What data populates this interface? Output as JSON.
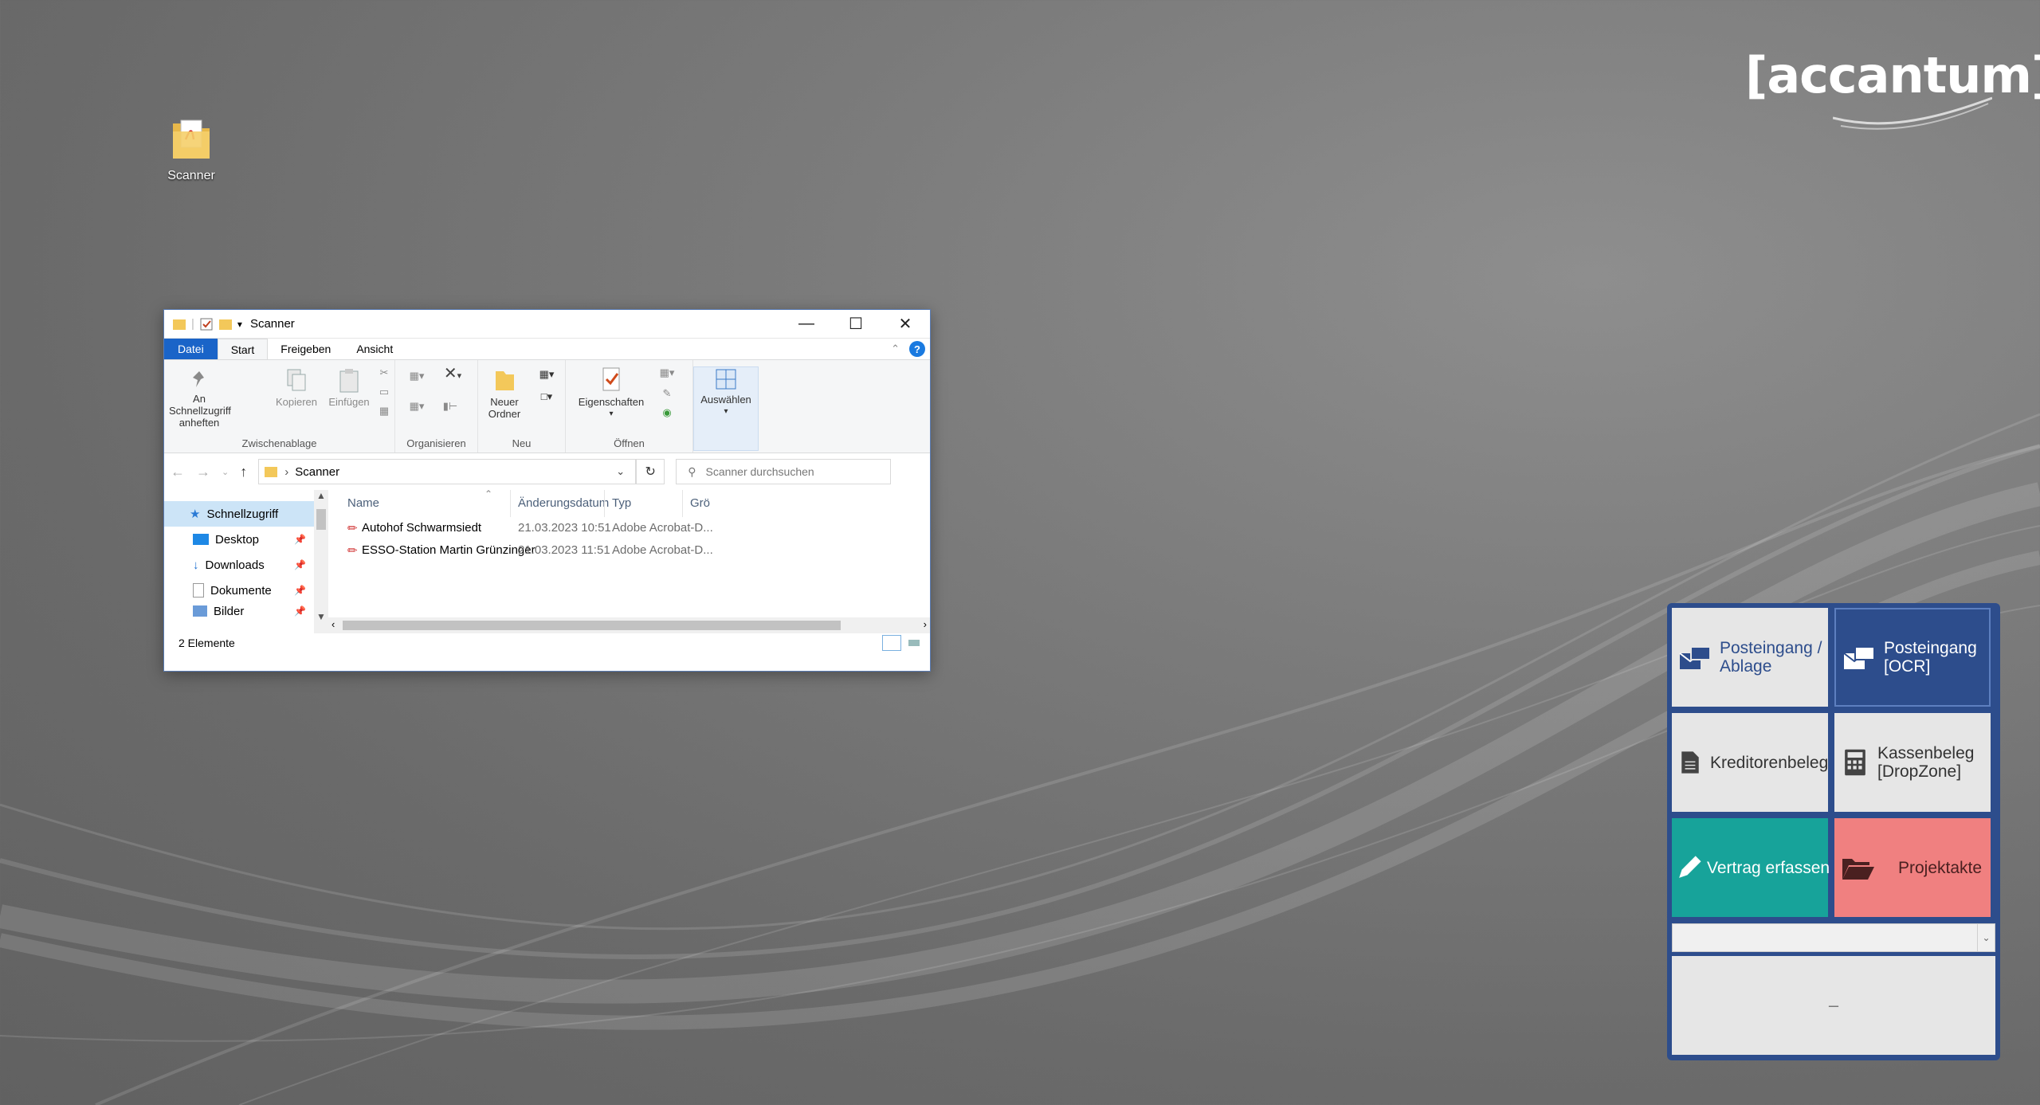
{
  "desktop": {
    "brand_text": "[accantum]",
    "icons": [
      {
        "label": "Scanner"
      }
    ]
  },
  "explorer": {
    "title": "Scanner",
    "tabs": {
      "file": "Datei",
      "start": "Start",
      "share": "Freigeben",
      "view": "Ansicht"
    },
    "ribbon": {
      "pin_quick": "An Schnellzugriff anheften",
      "copy": "Kopieren",
      "paste": "Einfügen",
      "group_clipboard": "Zwischenablage",
      "group_organize": "Organisieren",
      "new_folder": "Neuer Ordner",
      "group_new": "Neu",
      "properties": "Eigenschaften",
      "group_open": "Öffnen",
      "select": "Auswählen"
    },
    "address": {
      "path": "Scanner",
      "search_placeholder": "Scanner durchsuchen"
    },
    "nav_pane": [
      {
        "label": "Schnellzugriff",
        "icon": "star-icon",
        "selected": true
      },
      {
        "label": "Desktop",
        "icon": "desktop-icon",
        "pinned": true
      },
      {
        "label": "Downloads",
        "icon": "download-arrow-icon",
        "pinned": true
      },
      {
        "label": "Dokumente",
        "icon": "document-icon",
        "pinned": true
      },
      {
        "label": "Bilder",
        "icon": "pictures-icon",
        "pinned": true
      }
    ],
    "columns": {
      "name": "Name",
      "date": "Änderungsdatum",
      "type": "Typ",
      "size": "Grö"
    },
    "files": [
      {
        "name": "Autohof Schwarmsiedt",
        "date": "21.03.2023 10:51",
        "type": "Adobe Acrobat-D..."
      },
      {
        "name": "ESSO-Station Martin Grünzinger",
        "date": "21.03.2023 11:51",
        "type": "Adobe Acrobat-D..."
      }
    ],
    "status": "2 Elemente"
  },
  "panel": {
    "tiles": {
      "inbox_archive": "Posteingang / Ablage",
      "inbox_ocr": "Posteingang [OCR]",
      "creditor": "Kreditorenbeleg",
      "cash": "Kassenbeleg [DropZone]",
      "contract": "Vertrag erfassen",
      "project": "Projektakte"
    },
    "dropzone_text": "–"
  },
  "colors": {
    "panel_blue": "#2d4d8c",
    "tile_teal": "#17a39a",
    "tile_pink": "#f08080",
    "tile_light": "#e6e6e6",
    "explorer_file_tab": "#1a64c8"
  }
}
